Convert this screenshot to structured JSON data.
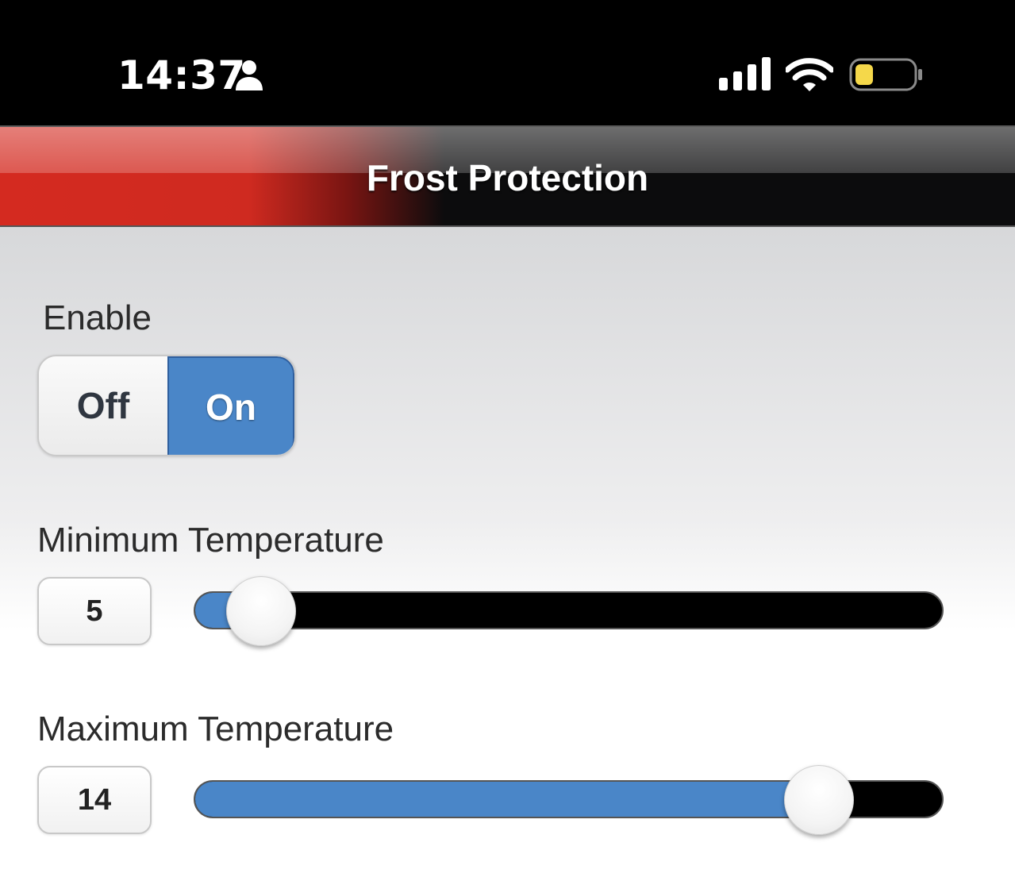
{
  "status_bar": {
    "time": "14:37",
    "battery_level": 0.25,
    "battery_color": "#f5d84a"
  },
  "header": {
    "title": "Frost Protection",
    "accent_color": "#d42a20"
  },
  "enable": {
    "label": "Enable",
    "off_label": "Off",
    "on_label": "On",
    "selected": "On",
    "selected_color": "#4a86c8"
  },
  "min_temperature": {
    "label": "Minimum Temperature",
    "value": "5",
    "fill_fraction": 0.087
  },
  "max_temperature": {
    "label": "Maximum Temperature",
    "value": "14",
    "fill_fraction": 0.834
  }
}
